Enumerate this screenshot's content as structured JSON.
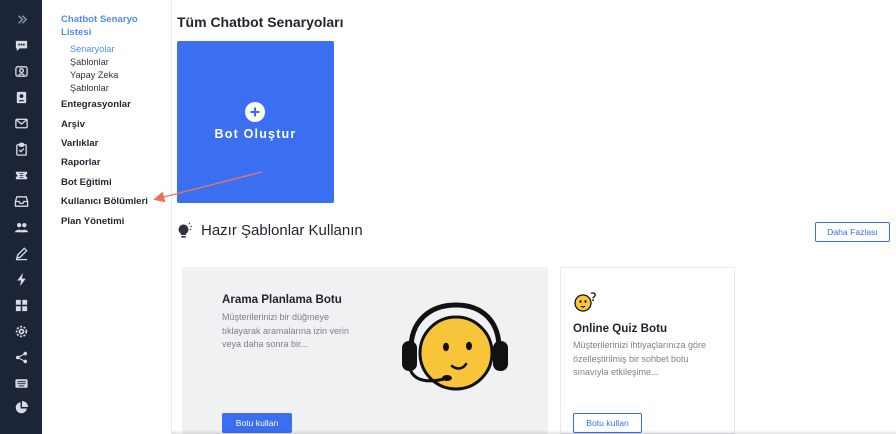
{
  "rail": {
    "icons": [
      "chevron-right-icon",
      "chat-icon",
      "team-icon",
      "contact-card-icon",
      "mail-icon",
      "clipboard-icon",
      "ticket-icon",
      "inbox-icon",
      "users-icon",
      "pen-icon",
      "lightning-icon",
      "grid-icon",
      "settings-icon",
      "share-icon",
      "keyboard-icon",
      "pie-chart-icon"
    ]
  },
  "subnav": {
    "active_group": "Chatbot Senaryo Listesi",
    "sub_items": [
      "Senaryolar",
      "Şablonlar",
      "Yapay Zeka",
      "Şablonlar"
    ],
    "groups": [
      "Entegrasyonlar",
      "Arşiv",
      "Varlıklar",
      "Raporlar",
      "Bot Eğitimi",
      "Kullanıcı Bölümleri",
      "Plan Yönetimi"
    ]
  },
  "main": {
    "title": "Tüm Chatbot Senaryoları",
    "create_label": "Bot Oluştur",
    "section_title": "Hazır Şablonlar Kullanın",
    "more_label": "Daha Fazlası",
    "templates": [
      {
        "title": "Arama Planlama Botu",
        "desc": "Müşterilerinizi bir düğmeye tıklayarak aramalarına izin verin veya daha sonra bir...",
        "button": "Botu kullan"
      },
      {
        "title": "Online Quiz Botu",
        "desc": "Müşterilerinizi ihtiyaçlarınıza göre özelleştirilmiş bir sohbet botu sınavıyla etkileşime...",
        "button": "Botu kullan"
      }
    ]
  },
  "colors": {
    "rail_bg": "#1c2537",
    "accent": "#3a6ff2",
    "nav_active": "#4f8ef0",
    "card_bg": "#f0f1f3",
    "annotation_arrow": "#e8735e",
    "mascot_yellow": "#f8c43a"
  }
}
